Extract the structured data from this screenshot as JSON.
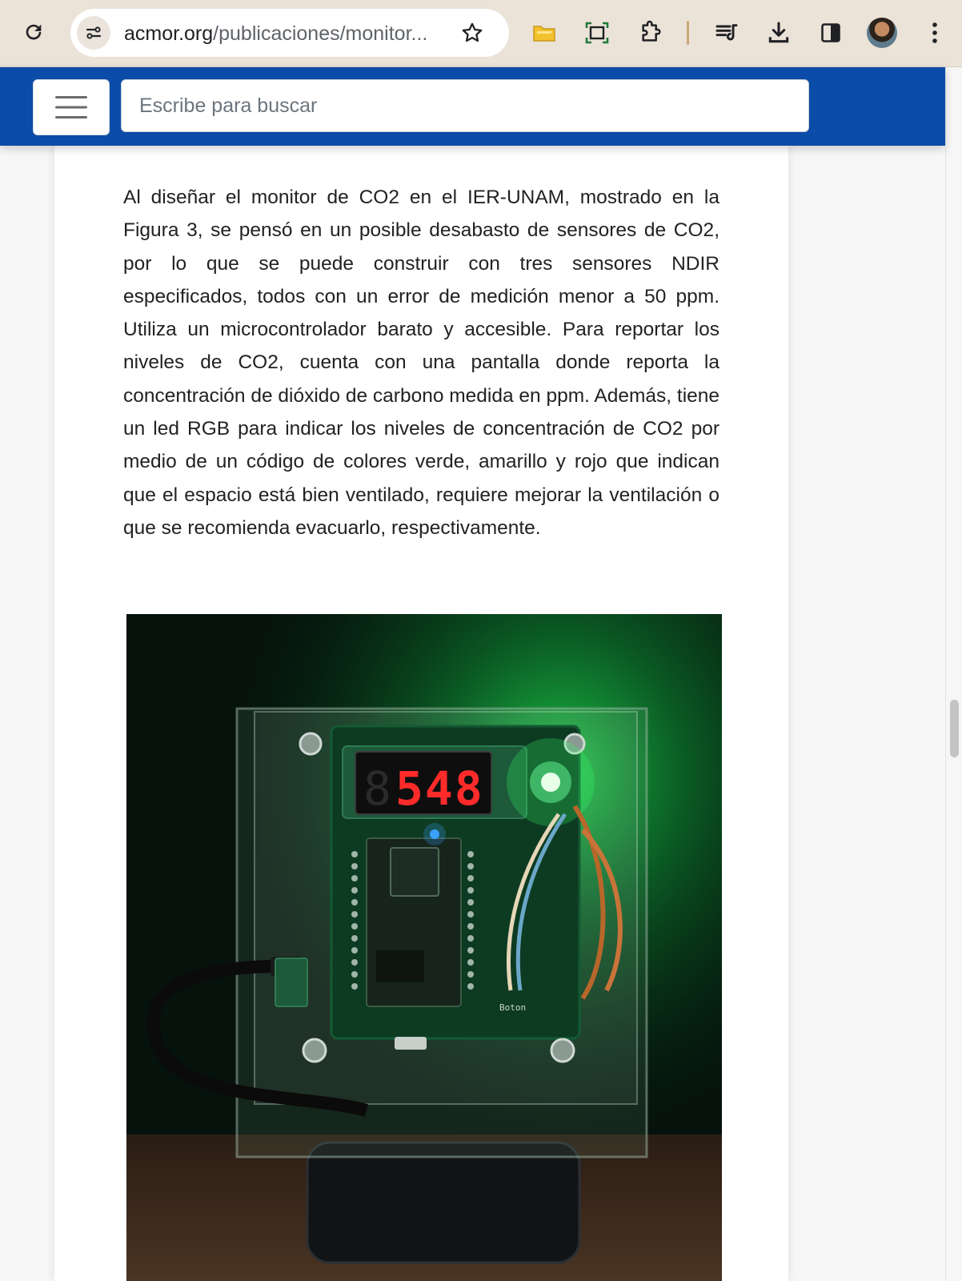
{
  "browser": {
    "url_domain": "acmor.org",
    "url_path": "/publicaciones/monitor...",
    "icons": [
      "reload-icon",
      "site-info-icon",
      "star-icon",
      "folder-extension-icon",
      "screenshot-extension-icon",
      "puzzle-extensions-icon",
      "media-control-icon",
      "download-icon",
      "side-panel-icon",
      "profile-avatar",
      "kebab-menu-icon"
    ]
  },
  "site": {
    "search_placeholder": "Escribe para buscar",
    "brand_color": "#0b4ca8"
  },
  "article": {
    "paragraph": "Al diseñar el monitor de CO2 en el IER-UNAM, mostrado en la Figura 3, se pensó en un posible desabasto de sensores de CO2, por lo que se puede construir con tres sensores NDIR especificados, todos con un error de medición menor a 50 ppm. Utiliza un microcontrolador barato y accesible. Para reportar los niveles de CO2, cuenta con una pantalla donde reporta la concentración de dióxido de carbono medida en ppm. Además, tiene un led RGB para indicar los niveles de concentración de CO2 por medio de un código de colores verde, amarillo y rojo que indican que el espacio está bien ventilado, requiere mejorar la ventilación o que se recomienda evacuarlo, respectivamente."
  },
  "figure": {
    "display_digits": "548",
    "board_label": "Boton"
  }
}
